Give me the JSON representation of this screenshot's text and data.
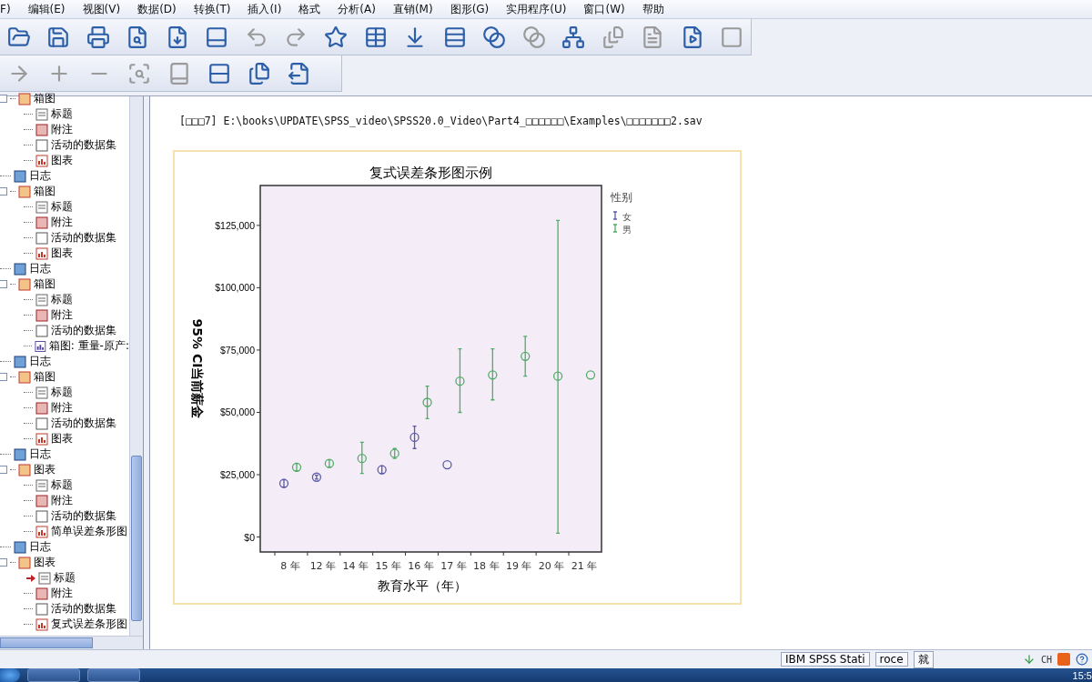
{
  "menu": [
    "F)",
    "编辑(E)",
    "视图(V)",
    "数据(D)",
    "转换(T)",
    "插入(I)",
    "格式",
    "分析(A)",
    "直销(M)",
    "图形(G)",
    "实用程序(U)",
    "窗口(W)",
    "帮助"
  ],
  "tree": [
    {
      "label": "箱图",
      "kind": "group",
      "children": [
        {
          "label": "标题",
          "kind": "title",
          "current": false
        },
        {
          "label": "附注",
          "kind": "notes",
          "current": false
        },
        {
          "label": "活动的数据集",
          "kind": "dataset",
          "current": false
        },
        {
          "label": "图表",
          "kind": "chart",
          "current": false
        }
      ]
    },
    {
      "label": "日志",
      "kind": "log"
    },
    {
      "label": "箱图",
      "kind": "group",
      "children": [
        {
          "label": "标题",
          "kind": "title",
          "current": false
        },
        {
          "label": "附注",
          "kind": "notes",
          "current": false
        },
        {
          "label": "活动的数据集",
          "kind": "dataset",
          "current": false
        },
        {
          "label": "图表",
          "kind": "chart",
          "current": false
        }
      ]
    },
    {
      "label": "日志",
      "kind": "log"
    },
    {
      "label": "箱图",
      "kind": "group",
      "children": [
        {
          "label": "标题",
          "kind": "title",
          "current": false
        },
        {
          "label": "附注",
          "kind": "notes",
          "current": false
        },
        {
          "label": "活动的数据集",
          "kind": "dataset",
          "current": false
        },
        {
          "label": "箱图: 重量-原产:",
          "kind": "boxplot",
          "current": false
        }
      ]
    },
    {
      "label": "日志",
      "kind": "log"
    },
    {
      "label": "箱图",
      "kind": "group",
      "children": [
        {
          "label": "标题",
          "kind": "title",
          "current": false
        },
        {
          "label": "附注",
          "kind": "notes",
          "current": false
        },
        {
          "label": "活动的数据集",
          "kind": "dataset",
          "current": false
        },
        {
          "label": "图表",
          "kind": "chart",
          "current": false
        }
      ]
    },
    {
      "label": "日志",
      "kind": "log"
    },
    {
      "label": "图表",
      "kind": "group",
      "children": [
        {
          "label": "标题",
          "kind": "title",
          "current": false
        },
        {
          "label": "附注",
          "kind": "notes",
          "current": false
        },
        {
          "label": "活动的数据集",
          "kind": "dataset",
          "current": false
        },
        {
          "label": "简单误差条形图",
          "kind": "chart",
          "current": false
        }
      ]
    },
    {
      "label": "日志",
      "kind": "log"
    },
    {
      "label": "图表",
      "kind": "group",
      "children": [
        {
          "label": "标题",
          "kind": "title",
          "current": true
        },
        {
          "label": "附注",
          "kind": "notes",
          "current": false
        },
        {
          "label": "活动的数据集",
          "kind": "dataset",
          "current": false
        },
        {
          "label": "复式误差条形图",
          "kind": "chart",
          "current": false
        }
      ]
    }
  ],
  "output": {
    "dataset_path": "[□□□7] E:\\books\\UPDATE\\SPSS_video\\SPSS20.0_Video\\Part4_□□□□□□\\Examples\\□□□□□□□2.sav",
    "chart_data": {
      "type": "scatter",
      "title": "复式误差条形图示例",
      "xlabel": "教育水平（年）",
      "ylabel": "95% CI当前薪金",
      "categories": [
        "8 年",
        "12 年",
        "14 年",
        "15 年",
        "16 年",
        "17 年",
        "18 年",
        "19 年",
        "20 年",
        "21 年"
      ],
      "legend": {
        "title": "性别"
      },
      "series": [
        {
          "name": "女",
          "color": "#5b5ba8",
          "values": [
            21500,
            24000,
            null,
            27000,
            40000,
            29000,
            null,
            null,
            null,
            null
          ],
          "errors": [
            [
              20000,
              23000
            ],
            [
              23200,
              24800
            ],
            null,
            [
              25500,
              28500
            ],
            [
              35500,
              44500
            ],
            null,
            null,
            null,
            null,
            null
          ]
        },
        {
          "name": "男",
          "color": "#4fae66",
          "values": [
            28000,
            29500,
            31500,
            33500,
            54000,
            62500,
            65000,
            72500,
            64500,
            65000
          ],
          "errors": [
            [
              26500,
              29500
            ],
            [
              28000,
              31000
            ],
            [
              25500,
              38000
            ],
            [
              31500,
              35500
            ],
            [
              47500,
              60500
            ],
            [
              50000,
              75500
            ],
            [
              55000,
              75500
            ],
            [
              64500,
              80500
            ],
            [
              1500,
              127000
            ],
            null
          ]
        }
      ],
      "ylim": [
        -6000,
        141000
      ],
      "yticks": [
        {
          "value": 0,
          "label": "$0"
        },
        {
          "value": 25000,
          "label": "$25,000"
        },
        {
          "value": 50000,
          "label": "$50,000"
        },
        {
          "value": 75000,
          "label": "$75,000"
        },
        {
          "value": 100000,
          "label": "$100,000"
        },
        {
          "value": 125000,
          "label": "$125,000"
        }
      ]
    }
  },
  "status_bar": [
    "IBM SPSS Stati",
    "roce",
    "就"
  ],
  "tray": {
    "language": "CH",
    "clock": "15:5"
  }
}
